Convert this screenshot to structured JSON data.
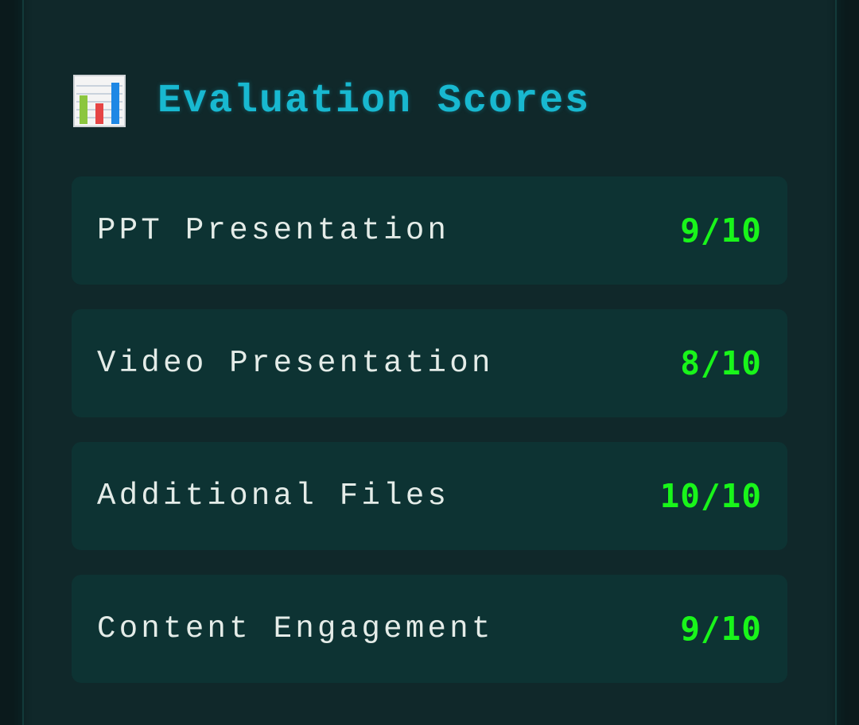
{
  "header": {
    "icon": "bar-chart-icon",
    "title": "Evaluation Scores"
  },
  "scores": [
    {
      "label": "PPT Presentation",
      "value": "9/10"
    },
    {
      "label": "Video Presentation",
      "value": "8/10"
    },
    {
      "label": "Additional Files",
      "value": "10/10"
    },
    {
      "label": "Content Engagement",
      "value": "9/10"
    }
  ],
  "colors": {
    "background": "#0b1a1c",
    "panel": "#10282a",
    "row": "#0d3333",
    "title": "#18b8d0",
    "label": "#e4ece8",
    "score": "#19f51a"
  }
}
